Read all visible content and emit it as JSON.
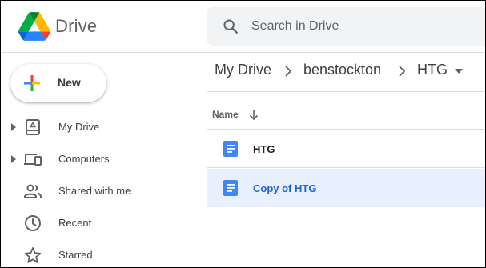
{
  "header": {
    "app_name": "Drive",
    "search": {
      "placeholder": "Search in Drive",
      "value": ""
    }
  },
  "sidebar": {
    "new_button": {
      "label": "New"
    },
    "items": [
      {
        "label": "My Drive",
        "icon": "my-drive-icon",
        "expandable": true
      },
      {
        "label": "Computers",
        "icon": "computers-icon",
        "expandable": true
      },
      {
        "label": "Shared with me",
        "icon": "shared-with-me-icon",
        "expandable": false
      },
      {
        "label": "Recent",
        "icon": "clock-icon",
        "expandable": false
      },
      {
        "label": "Starred",
        "icon": "star-icon",
        "expandable": false
      }
    ]
  },
  "breadcrumb": [
    "My Drive",
    "benstockton",
    "HTG"
  ],
  "file_list": {
    "column_name": "Name",
    "sort": "descending",
    "rows": [
      {
        "name": "HTG",
        "type": "google-doc",
        "selected": false
      },
      {
        "name": "Copy of HTG",
        "type": "google-doc",
        "selected": true
      }
    ]
  },
  "colors": {
    "doc_blue": "#4285f4",
    "selected_bg": "#e8f0fe",
    "selected_text": "#1967d2",
    "search_bg": "#f1f3f4"
  }
}
